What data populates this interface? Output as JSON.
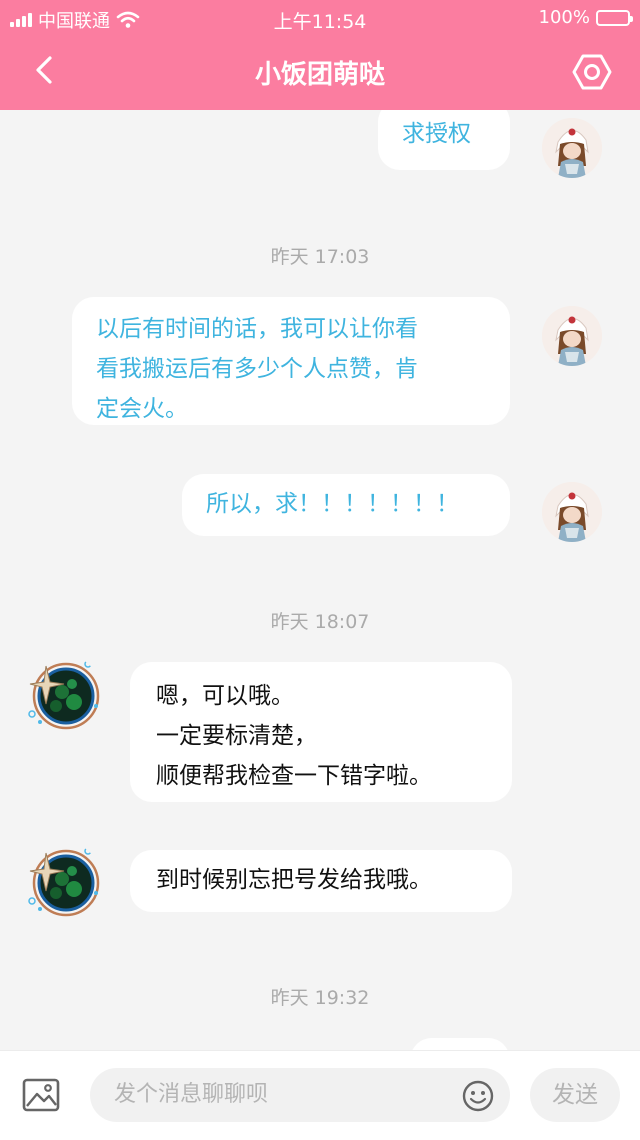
{
  "status_bar": {
    "carrier": "中国联通",
    "time": "上午11:54",
    "battery": "100%"
  },
  "nav": {
    "title": "小饭团萌哒",
    "back_icon": "chevron-left-icon",
    "settings_icon": "settings-hexagon-icon"
  },
  "colors": {
    "header": "#fb7da0",
    "out_text": "#3fb4df",
    "background": "#f4f4f4"
  },
  "messages": {
    "m1": "求授权",
    "t1": "昨天 17:03",
    "m2a": "以后有时间的话，我可以让你看",
    "m2b": "看我搬运后有多少个人点赞，肯",
    "m2c": "定会火。",
    "m3": "所以，求！！！！！！！",
    "t2": "昨天 18:07",
    "m4a": "嗯，可以哦。",
    "m4b": "一定要标清楚，",
    "m4c": "顺便帮我检查一下错字啦。",
    "m5": "到时候别忘把号发给我哦。",
    "t3": "昨天 19:32"
  },
  "input": {
    "placeholder": "发个消息聊聊呗",
    "send_label": "发送"
  }
}
